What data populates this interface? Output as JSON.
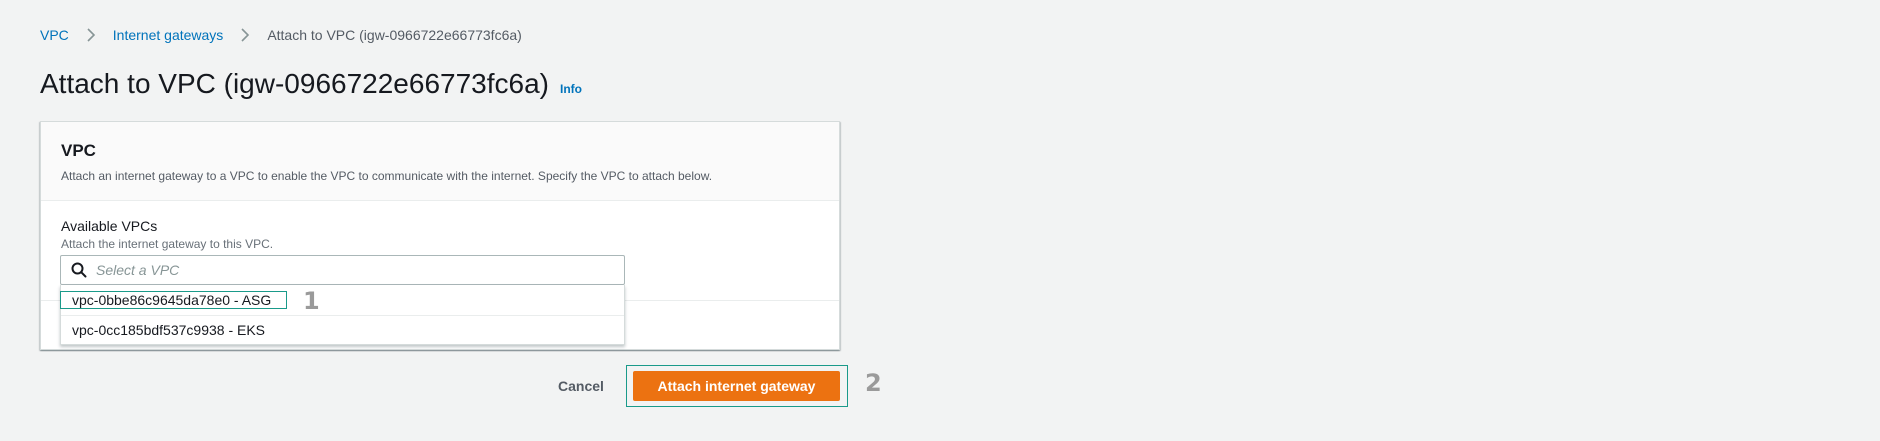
{
  "breadcrumb": {
    "items": [
      {
        "label": "VPC"
      },
      {
        "label": "Internet gateways"
      }
    ],
    "current": "Attach to VPC (igw-0966722e66773fc6a)"
  },
  "page": {
    "title": "Attach to VPC (igw-0966722e66773fc6a)",
    "info_label": "Info"
  },
  "panel": {
    "title": "VPC",
    "description": "Attach an internet gateway to a VPC to enable the VPC to communicate with the internet. Specify the VPC to attach below."
  },
  "field": {
    "label": "Available VPCs",
    "description": "Attach the internet gateway to this VPC.",
    "placeholder": "Select a VPC",
    "value": "",
    "options": [
      {
        "label": "vpc-0bbe86c9645da78e0 - ASG"
      },
      {
        "label": "vpc-0cc185bdf537c9938 - EKS"
      }
    ]
  },
  "actions": {
    "cancel_label": "Cancel",
    "primary_label": "Attach internet gateway"
  },
  "annotations": {
    "marker_1": "1",
    "marker_2": "2"
  },
  "colors": {
    "accent": "#ec7211",
    "link": "#0073bb",
    "highlight": "#1a9a8a"
  },
  "icons": {
    "breadcrumb_separator": "chevron-right-icon",
    "search": "search-icon"
  }
}
